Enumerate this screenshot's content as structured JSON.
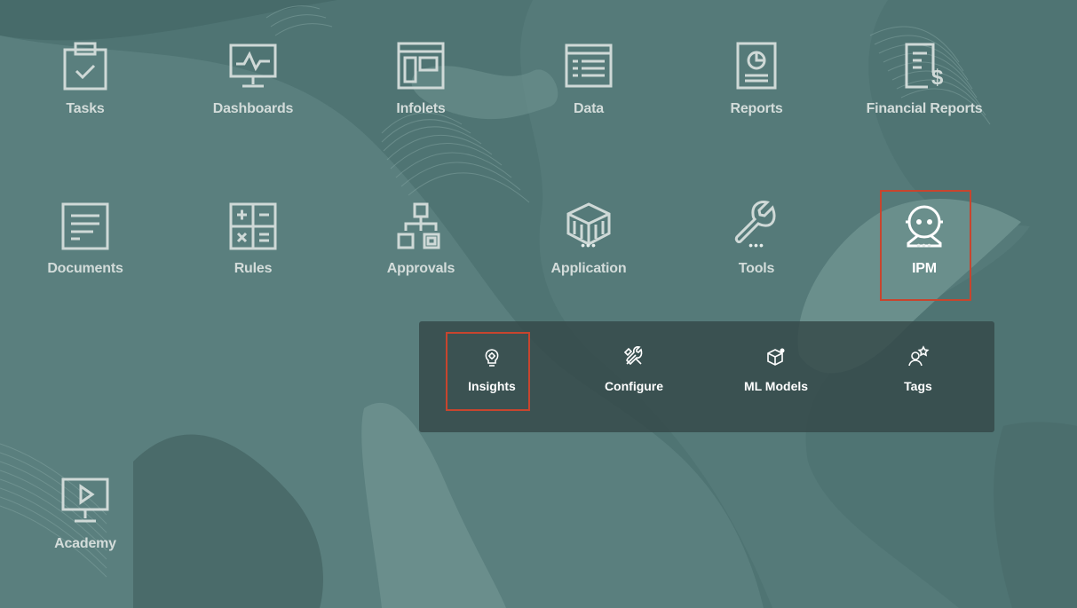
{
  "colors": {
    "background": "#4f7473",
    "icon_stroke": "#cfd9d7",
    "label": "#d3dcda",
    "highlight": "#c8452e",
    "submenu_bg": "#344848"
  },
  "tiles": [
    {
      "label": "Tasks",
      "icon": "clipboard-check-icon"
    },
    {
      "label": "Dashboards",
      "icon": "monitor-chart-icon"
    },
    {
      "label": "Infolets",
      "icon": "infolet-panel-icon"
    },
    {
      "label": "Data",
      "icon": "data-grid-icon"
    },
    {
      "label": "Reports",
      "icon": "report-pie-icon"
    },
    {
      "label": "Financial Reports",
      "icon": "financial-report-icon"
    },
    {
      "label": "Documents",
      "icon": "document-lines-icon"
    },
    {
      "label": "Rules",
      "icon": "calculator-icon"
    },
    {
      "label": "Approvals",
      "icon": "hierarchy-icon"
    },
    {
      "label": "Application",
      "icon": "cube-icon",
      "more": "•••"
    },
    {
      "label": "Tools",
      "icon": "wrench-icon",
      "more": "•••"
    },
    {
      "label": "IPM",
      "icon": "robot-icon",
      "more": "•••"
    },
    {
      "label": "Academy",
      "icon": "play-monitor-icon"
    }
  ],
  "submenu": {
    "items": [
      {
        "label": "Insights",
        "icon": "lightbulb-icon"
      },
      {
        "label": "Configure",
        "icon": "tools-icon"
      },
      {
        "label": "ML Models",
        "icon": "ml-cube-icon"
      },
      {
        "label": "Tags",
        "icon": "person-star-icon"
      }
    ]
  }
}
